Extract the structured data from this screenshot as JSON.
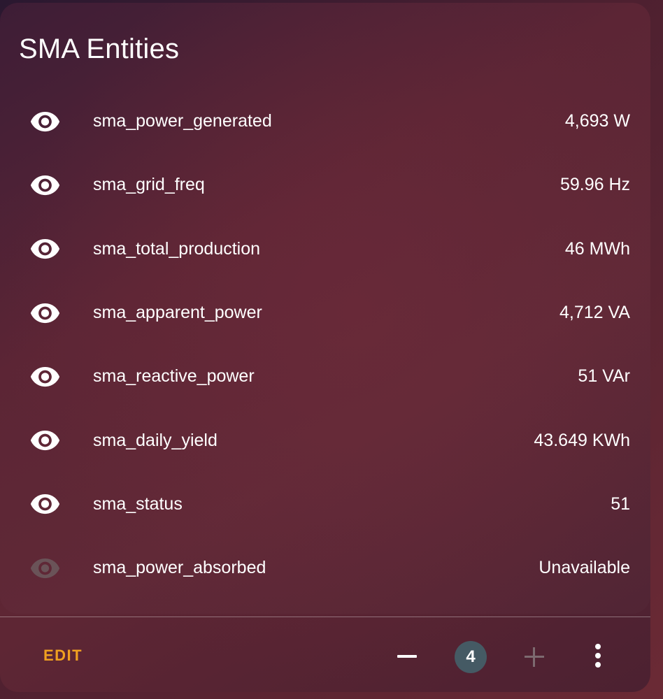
{
  "card": {
    "title": "SMA Entities"
  },
  "entities": [
    {
      "name": "sma_power_generated",
      "value": "4,693 W",
      "icon": "eye-icon",
      "available": true
    },
    {
      "name": "sma_grid_freq",
      "value": "59.96 Hz",
      "icon": "eye-icon",
      "available": true
    },
    {
      "name": "sma_total_production",
      "value": "46 MWh",
      "icon": "eye-icon",
      "available": true
    },
    {
      "name": "sma_apparent_power",
      "value": "4,712 VA",
      "icon": "eye-icon",
      "available": true
    },
    {
      "name": "sma_reactive_power",
      "value": "51 VAr",
      "icon": "eye-icon",
      "available": true
    },
    {
      "name": "sma_daily_yield",
      "value": "43.649 KWh",
      "icon": "eye-icon",
      "available": true
    },
    {
      "name": "sma_status",
      "value": "51",
      "icon": "eye-icon",
      "available": true
    },
    {
      "name": "sma_power_absorbed",
      "value": "Unavailable",
      "icon": "eye-icon",
      "available": false
    }
  ],
  "footer": {
    "edit_label": "EDIT",
    "minus_icon": "minus-icon",
    "count": "4",
    "plus_icon": "plus-icon",
    "more_icon": "more-vertical-icon"
  },
  "colors": {
    "accent": "#f0a020",
    "badge": "#455a64",
    "text": "#ffffff",
    "unavailable_icon": "#6a5358"
  }
}
